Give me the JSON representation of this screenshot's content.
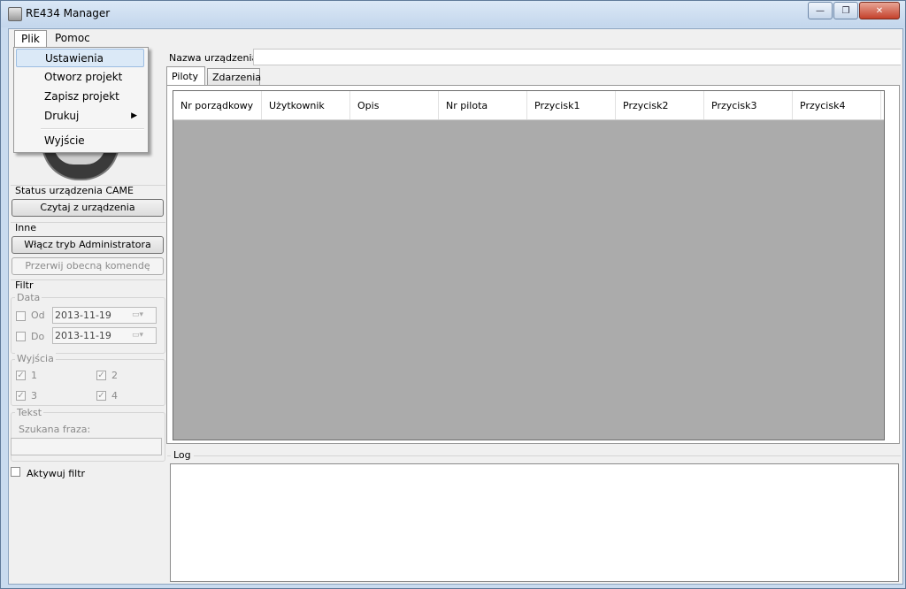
{
  "window": {
    "title": "RE434 Manager",
    "minimize": "—",
    "maximize": "❐",
    "close": "✕"
  },
  "menu": {
    "items": [
      "Plik",
      "Pomoc"
    ],
    "dropdown": [
      "Ustawienia",
      "Otworz projekt",
      "Zapisz projekt",
      "Drukuj",
      "Wyjście"
    ]
  },
  "sidebar": {
    "status_label": "Status urządzenia CAME",
    "read_button": "Czytaj z urządzenia",
    "other_label": "Inne",
    "admin_button": "Włącz tryb Administratora",
    "abort_button": "Przerwij obecną komendę",
    "filter": {
      "label": "Filtr",
      "date_legend": "Data",
      "from_label": "Od",
      "from_value": "2013-11-19",
      "to_label": "Do",
      "to_value": "2013-11-19",
      "outputs_legend": "Wyjścia",
      "outputs": [
        "1",
        "2",
        "3",
        "4"
      ],
      "text_legend": "Tekst",
      "search_label": "Szukana fraza:",
      "activate_label": "Aktywuj filtr"
    }
  },
  "main": {
    "device_name_label": "Nazwa urządzenia:",
    "tabs": [
      "Piloty",
      "Zdarzenia"
    ],
    "columns": [
      "Nr porządkowy",
      "Użytkownik",
      "Opis",
      "Nr pilota",
      "Przycisk1",
      "Przycisk2",
      "Przycisk3",
      "Przycisk4"
    ],
    "log_label": "Log"
  },
  "colors": {
    "grid_background": "#ababab",
    "menu_highlight": "#dbe9f7"
  }
}
